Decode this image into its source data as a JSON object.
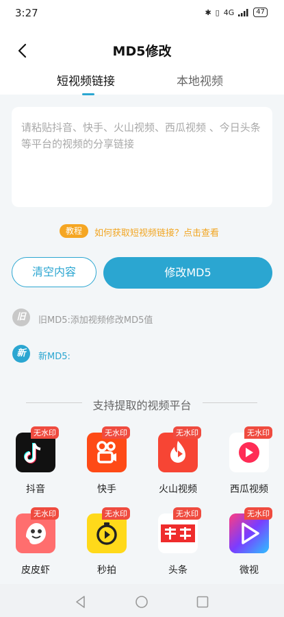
{
  "status_bar": {
    "time": "3:27",
    "network": "4G",
    "battery": "47"
  },
  "header": {
    "title": "MD5修改"
  },
  "tabs": [
    {
      "label": "短视频链接"
    },
    {
      "label": "本地视频"
    }
  ],
  "input": {
    "placeholder": "请粘贴抖音、快手、火山视频、西瓜视频 、今日头条等平台的视频的分享链接",
    "value": ""
  },
  "tutorial": {
    "badge": "教程",
    "link_text": "如何获取短视频链接？点击查看"
  },
  "buttons": {
    "clear": "清空内容",
    "modify": "修改MD5"
  },
  "md5": {
    "old_icon": "旧",
    "old_text": "旧MD5:添加视频修改MD5值",
    "new_icon": "新",
    "new_text": "新MD5:"
  },
  "platforms": {
    "title": "支持提取的视频平台",
    "badge": "无水印",
    "items": [
      {
        "name": "抖音",
        "icon": "douyin-icon",
        "color": "#111111"
      },
      {
        "name": "快手",
        "icon": "kuaishou-icon",
        "color": "#fe4a16"
      },
      {
        "name": "火山视频",
        "icon": "huoshan-icon",
        "color": "#f74534"
      },
      {
        "name": "西瓜视频",
        "icon": "xigua-icon",
        "color": "#ff2c55"
      },
      {
        "name": "皮皮虾",
        "icon": "pipixia-icon",
        "color": "#ff6e6e"
      },
      {
        "name": "秒拍",
        "icon": "miaopai-icon",
        "color": "#ffd91a"
      },
      {
        "name": "头条",
        "icon": "toutiao-icon",
        "color": "#ef2c2c"
      },
      {
        "name": "微视",
        "icon": "weishi-icon",
        "color": "#6a3cf6"
      }
    ]
  },
  "colors": {
    "accent": "#2ba6d1",
    "tutorial": "#f5a623",
    "badge": "#ef4b3f"
  }
}
